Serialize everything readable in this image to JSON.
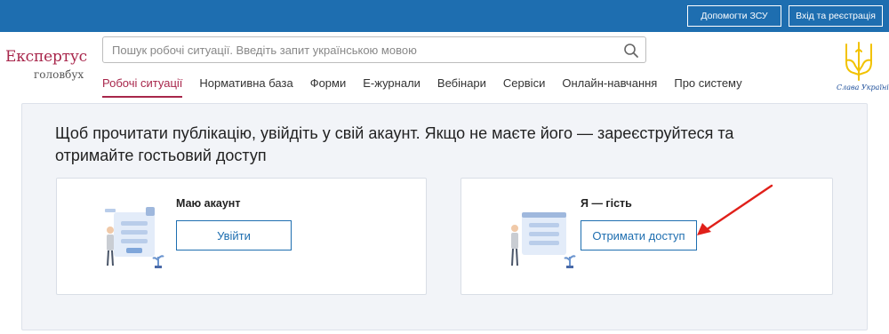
{
  "topbar": {
    "help_zsu": "Допомогти ЗСУ",
    "login_register": "Вхід та реєстрація"
  },
  "logo": {
    "main": "Експертус",
    "sub": "головбух"
  },
  "search": {
    "placeholder": "Пошук робочі ситуації. Введіть запит українською мовою",
    "icon": "search-icon"
  },
  "nav": {
    "items": [
      "Робочі ситуації",
      "Нормативна база",
      "Форми",
      "Е-журнали",
      "Вебінари",
      "Сервіси",
      "Онлайн-навчання",
      "Про систему"
    ],
    "active": "Робочі ситуації"
  },
  "ukraine": {
    "slogan": "Слава Україні!"
  },
  "main": {
    "headline": "Щоб прочитати публікацію, увійдіть у свій акаунт. Якщо не маєте його — зареєструйтеся та отримайте гостьовий доступ",
    "account_card": {
      "title": "Маю акаунт",
      "button": "Увійти"
    },
    "guest_card": {
      "title": "Я — гість",
      "button": "Отримати доступ"
    }
  },
  "colors": {
    "topbar": "#1e6eb0",
    "brand": "#a8264b",
    "annotation_arrow": "#e0201a"
  }
}
